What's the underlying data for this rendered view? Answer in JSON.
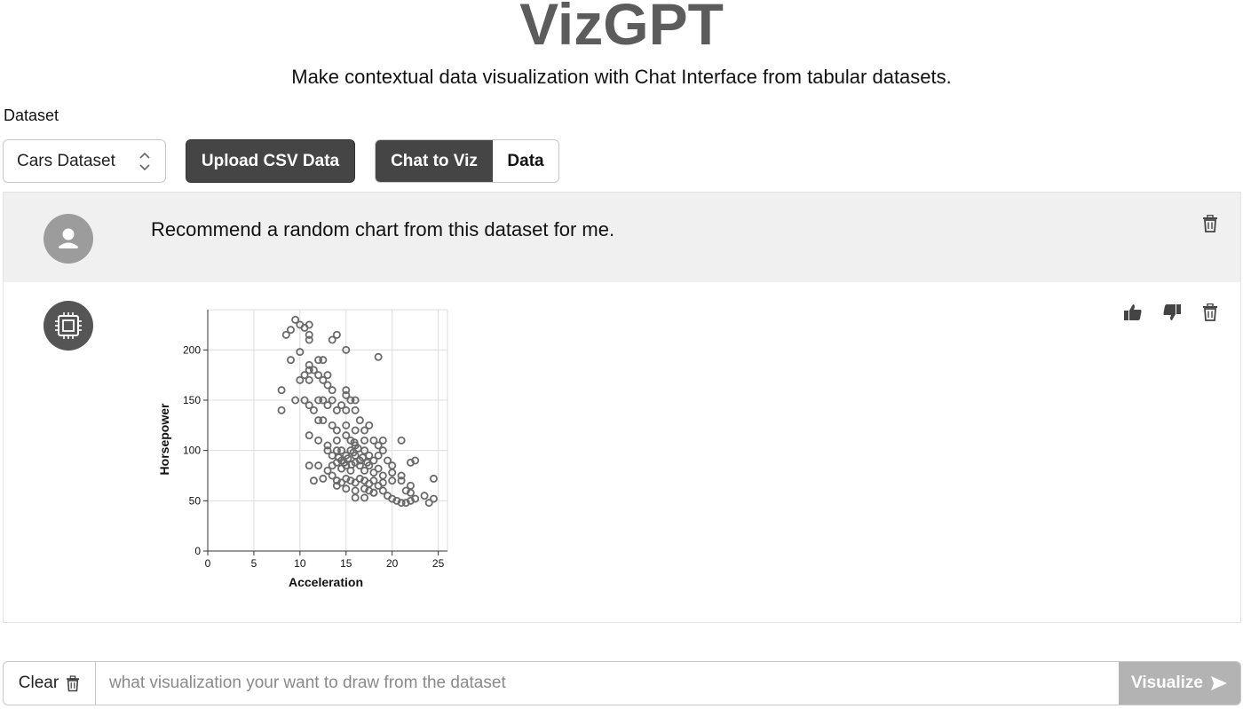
{
  "app": {
    "title": "VizGPT",
    "subtitle": "Make contextual data visualization with Chat Interface from tabular datasets."
  },
  "controls": {
    "dataset_label": "Dataset",
    "dataset_selected": "Cars Dataset",
    "upload_label": "Upload CSV Data",
    "tabs": [
      {
        "label": "Chat to Viz",
        "active": true
      },
      {
        "label": "Data",
        "active": false
      }
    ]
  },
  "messages": {
    "user_text": "Recommend a random chart from this dataset for me.",
    "icons": [
      "user-avatar-icon",
      "bot-chip-icon",
      "trash-icon",
      "thumbs-up-icon",
      "thumbs-down-icon"
    ]
  },
  "bottom": {
    "clear_label": "Clear",
    "placeholder": "what visualization your want to draw from the dataset",
    "visualize_label": "Visualize"
  },
  "colors": {
    "primary_dark": "#454545",
    "title_gray": "#5c5c5c",
    "user_row_bg": "#f0f0f0",
    "visualize_disabled": "#b3b3b3",
    "point_stroke": "#6a6a6a"
  },
  "chart_data": {
    "type": "scatter",
    "title": "",
    "xlabel": "Acceleration",
    "ylabel": "Horsepower",
    "xlim": [
      0,
      26
    ],
    "ylim": [
      0,
      240
    ],
    "xticks": [
      0,
      5,
      10,
      15,
      20,
      25
    ],
    "yticks": [
      0,
      50,
      100,
      150,
      200
    ],
    "grid": true,
    "legend": "none",
    "points": [
      [
        9.5,
        230
      ],
      [
        10,
        225
      ],
      [
        10.5,
        222
      ],
      [
        9,
        220
      ],
      [
        8.5,
        215
      ],
      [
        11,
        225
      ],
      [
        11,
        215
      ],
      [
        11,
        210
      ],
      [
        13.5,
        210
      ],
      [
        14,
        215
      ],
      [
        15,
        200
      ],
      [
        18.5,
        193
      ],
      [
        9,
        190
      ],
      [
        10,
        198
      ],
      [
        11,
        185
      ],
      [
        12,
        190
      ],
      [
        12.5,
        190
      ],
      [
        11,
        180
      ],
      [
        11.5,
        180
      ],
      [
        12,
        175
      ],
      [
        10.5,
        175
      ],
      [
        11,
        170
      ],
      [
        10,
        170
      ],
      [
        12.5,
        170
      ],
      [
        13,
        165
      ],
      [
        13.5,
        160
      ],
      [
        8,
        160
      ],
      [
        8,
        140
      ],
      [
        9.5,
        150
      ],
      [
        10.5,
        150
      ],
      [
        11,
        145
      ],
      [
        11.5,
        140
      ],
      [
        12,
        150
      ],
      [
        12.5,
        150
      ],
      [
        13,
        145
      ],
      [
        13.5,
        150
      ],
      [
        14,
        140
      ],
      [
        14.5,
        145
      ],
      [
        15,
        155
      ],
      [
        15.5,
        150
      ],
      [
        16,
        140
      ],
      [
        12,
        130
      ],
      [
        12.5,
        130
      ],
      [
        13.5,
        125
      ],
      [
        14,
        120
      ],
      [
        15,
        125
      ],
      [
        16,
        120
      ],
      [
        17,
        120
      ],
      [
        17.5,
        125
      ],
      [
        11,
        115
      ],
      [
        12,
        110
      ],
      [
        13,
        105
      ],
      [
        14,
        110
      ],
      [
        15,
        115
      ],
      [
        15.5,
        110
      ],
      [
        16,
        105
      ],
      [
        17,
        110
      ],
      [
        18,
        110
      ],
      [
        18.5,
        105
      ],
      [
        19,
        110
      ],
      [
        21,
        110
      ],
      [
        13,
        100
      ],
      [
        13.5,
        95
      ],
      [
        14,
        100
      ],
      [
        14.5,
        90
      ],
      [
        15,
        95
      ],
      [
        15.5,
        100
      ],
      [
        16,
        95
      ],
      [
        16.5,
        90
      ],
      [
        17,
        100
      ],
      [
        17.5,
        95
      ],
      [
        18,
        90
      ],
      [
        18.5,
        95
      ],
      [
        19,
        100
      ],
      [
        19.5,
        90
      ],
      [
        20,
        85
      ],
      [
        22,
        88
      ],
      [
        22.5,
        90
      ],
      [
        11,
        85
      ],
      [
        12,
        85
      ],
      [
        13,
        80
      ],
      [
        13.5,
        85
      ],
      [
        14,
        88
      ],
      [
        14.5,
        82
      ],
      [
        15,
        85
      ],
      [
        15.5,
        80
      ],
      [
        16,
        88
      ],
      [
        16.5,
        85
      ],
      [
        17,
        80
      ],
      [
        17.5,
        85
      ],
      [
        18,
        78
      ],
      [
        18.5,
        82
      ],
      [
        19,
        75
      ],
      [
        20,
        78
      ],
      [
        21,
        75
      ],
      [
        11.5,
        70
      ],
      [
        12.5,
        72
      ],
      [
        13.5,
        75
      ],
      [
        14,
        70
      ],
      [
        14.5,
        68
      ],
      [
        15,
        72
      ],
      [
        15.5,
        70
      ],
      [
        16,
        68
      ],
      [
        16.5,
        72
      ],
      [
        17,
        70
      ],
      [
        17.5,
        67
      ],
      [
        18,
        70
      ],
      [
        18.5,
        65
      ],
      [
        19,
        68
      ],
      [
        20,
        70
      ],
      [
        21,
        70
      ],
      [
        22,
        65
      ],
      [
        24.5,
        72
      ],
      [
        14,
        65
      ],
      [
        15,
        62
      ],
      [
        16,
        60
      ],
      [
        17,
        62
      ],
      [
        17.5,
        60
      ],
      [
        18,
        58
      ],
      [
        19,
        60
      ],
      [
        19.5,
        55
      ],
      [
        20,
        52
      ],
      [
        20.5,
        50
      ],
      [
        21,
        48
      ],
      [
        21.5,
        48
      ],
      [
        22,
        50
      ],
      [
        22.5,
        52
      ],
      [
        23.5,
        55
      ],
      [
        24,
        48
      ],
      [
        24.5,
        52
      ],
      [
        16,
        53
      ],
      [
        17,
        53
      ],
      [
        18,
        58
      ],
      [
        21.5,
        60
      ],
      [
        22,
        58
      ],
      [
        15,
        140
      ],
      [
        16.5,
        130
      ],
      [
        13,
        175
      ],
      [
        15,
        160
      ],
      [
        16,
        150
      ],
      [
        14.5,
        100
      ],
      [
        15.2,
        92
      ],
      [
        15.8,
        98
      ],
      [
        16.3,
        102
      ],
      [
        14.8,
        88
      ],
      [
        15.6,
        86
      ],
      [
        16.8,
        93
      ],
      [
        17.3,
        88
      ],
      [
        14.2,
        93
      ],
      [
        15.9,
        108
      ]
    ]
  }
}
